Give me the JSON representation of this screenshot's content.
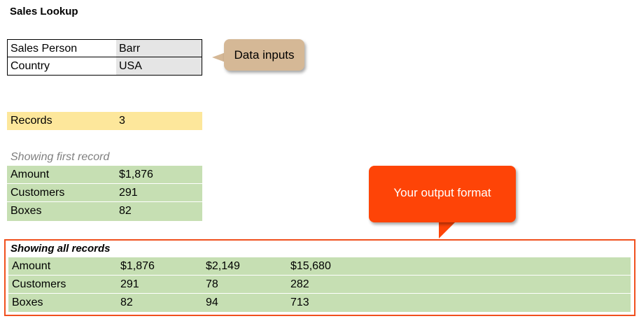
{
  "title": "Sales Lookup",
  "inputs": [
    {
      "label": "Sales Person",
      "value": "Barr"
    },
    {
      "label": "Country",
      "value": "USA"
    }
  ],
  "callouts": {
    "data_inputs": "Data inputs",
    "output_format": "Your output format"
  },
  "records": {
    "label": "Records",
    "value": "3"
  },
  "first_record": {
    "heading": "Showing first record",
    "rows": [
      {
        "label": "Amount",
        "value": "$1,876"
      },
      {
        "label": "Customers",
        "value": "291"
      },
      {
        "label": "Boxes",
        "value": "82"
      }
    ]
  },
  "all_records": {
    "heading": "Showing all records",
    "rows": [
      {
        "label": "Amount",
        "values": [
          "$1,876",
          "$2,149",
          "$15,680"
        ]
      },
      {
        "label": "Customers",
        "values": [
          "291",
          "78",
          "282"
        ]
      },
      {
        "label": "Boxes",
        "values": [
          "82",
          "94",
          "713"
        ]
      }
    ]
  },
  "colors": {
    "input_cell": "#e5e5e5",
    "records_fill": "#fde79b",
    "result_fill": "#c6dfb3",
    "highlight_border": "#f0501e",
    "callout_tan": "#d5b896",
    "callout_orange": "#fe4407"
  }
}
